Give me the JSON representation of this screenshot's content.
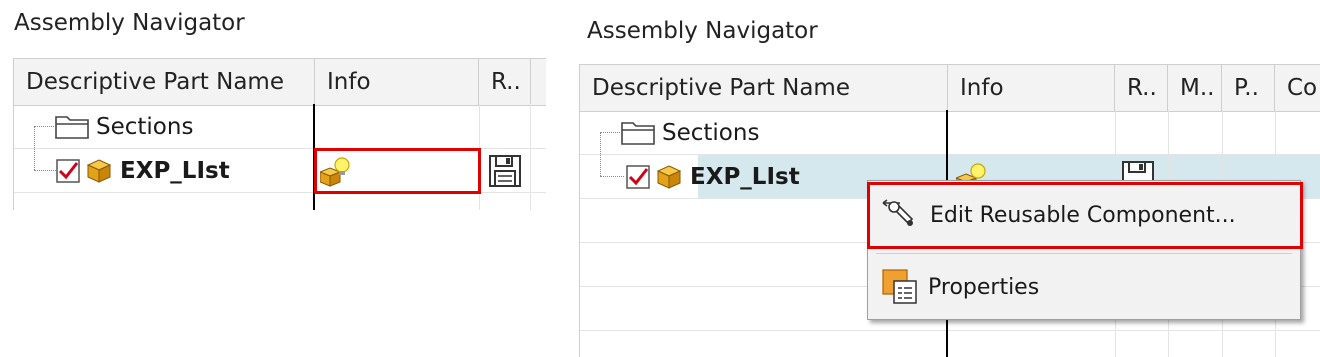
{
  "left": {
    "title": "Assembly Navigator",
    "columns": [
      "Descriptive Part Name",
      "Info",
      "R.."
    ],
    "rows": [
      {
        "name": "Sections",
        "checked": false
      },
      {
        "name": "EXP_LIst",
        "checked": true
      }
    ]
  },
  "right": {
    "title": "Assembly Navigator",
    "columns": [
      "Descriptive Part Name",
      "Info",
      "R..",
      "M..",
      "P..",
      "Co"
    ],
    "rows": [
      {
        "name": "Sections",
        "checked": false
      },
      {
        "name": "EXP_LIst",
        "checked": true,
        "selected": true
      }
    ],
    "context_menu": {
      "items": [
        {
          "label": "Edit Reusable Component...",
          "icon": "wrench-icon",
          "highlighted": true
        },
        {
          "label": "Properties",
          "icon": "properties-icon",
          "highlighted": false
        }
      ]
    }
  },
  "colors": {
    "highlight_border": "#e00000",
    "selection_bg": "#d5e8ee",
    "header_bg": "#f3f3f3",
    "menu_bg": "#f2f2f2"
  }
}
